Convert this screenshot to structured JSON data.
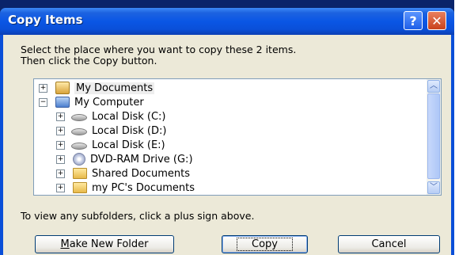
{
  "dialog": {
    "title": "Copy Items",
    "help_glyph": "?",
    "close_glyph": "✕",
    "message_line1": "Select the place where you want to copy these 2 items.",
    "message_line2": "Then click the Copy button.",
    "hint": "To view any subfolders, click a plus sign above."
  },
  "tree": {
    "items": [
      {
        "label": "My Documents",
        "icon": "my-documents-icon",
        "expander": "+"
      },
      {
        "label": "My Computer",
        "icon": "my-computer-icon",
        "expander": "−"
      },
      {
        "label": "Local Disk (C:)",
        "icon": "hard-disk-icon",
        "expander": "+"
      },
      {
        "label": "Local Disk (D:)",
        "icon": "hard-disk-icon",
        "expander": "+"
      },
      {
        "label": "Local Disk (E:)",
        "icon": "hard-disk-icon",
        "expander": "+"
      },
      {
        "label": "DVD-RAM Drive (G:)",
        "icon": "dvd-drive-icon",
        "expander": "+"
      },
      {
        "label": "Shared Documents",
        "icon": "folder-icon",
        "expander": "+"
      },
      {
        "label": "my PC's Documents",
        "icon": "folder-icon",
        "expander": "+"
      }
    ],
    "scroll_up_glyph": "︿",
    "scroll_down_glyph": "﹀"
  },
  "buttons": {
    "make_new_folder_mnemonic": "M",
    "make_new_folder_rest": "ake New Folder",
    "copy": "Copy",
    "cancel": "Cancel"
  },
  "colors": {
    "title_bar": "#0a56e5",
    "dialog_face": "#ece9d8",
    "close_button": "#c9421c"
  }
}
